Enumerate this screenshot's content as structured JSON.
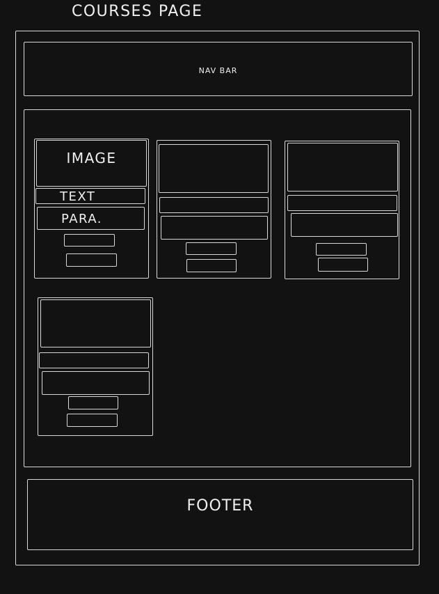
{
  "page_title": "COURSES PAGE",
  "navbar": {
    "label": "NAV BAR"
  },
  "cards": [
    {
      "image_label": "IMAGE",
      "text_label": "TEXT",
      "para_label": "PARA."
    },
    {
      "image_label": "",
      "text_label": "",
      "para_label": ""
    },
    {
      "image_label": "",
      "text_label": "",
      "para_label": ""
    },
    {
      "image_label": "",
      "text_label": "",
      "para_label": ""
    }
  ],
  "footer": {
    "label": "FOOTER"
  },
  "colors": {
    "background": "#121212",
    "stroke": "#d9d9d9",
    "text": "#f0f0f0"
  }
}
